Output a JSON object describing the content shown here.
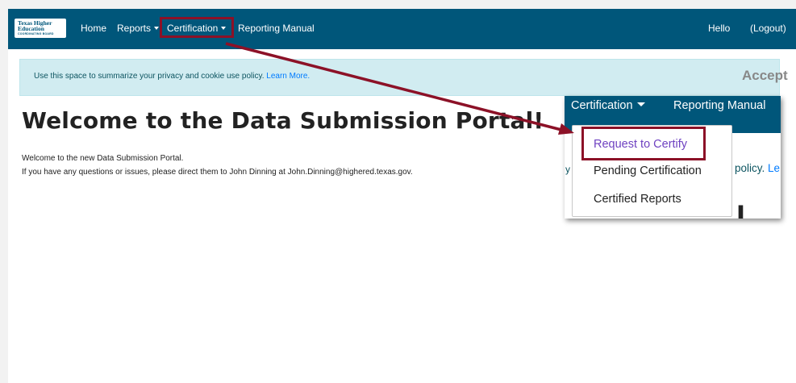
{
  "navbar": {
    "logo": {
      "line1": "Texas Higher",
      "line2": "Education",
      "line3": "COORDINATING BOARD"
    },
    "items": [
      {
        "label": "Home"
      },
      {
        "label": "Reports",
        "has_caret": true
      },
      {
        "label": "Certification",
        "has_caret": true,
        "highlighted": true
      },
      {
        "label": "Reporting Manual"
      }
    ],
    "right": {
      "greeting": "Hello",
      "logout": "(Logout)"
    },
    "background": "#00567a"
  },
  "cookie_banner": {
    "text": "Use this space to summarize your privacy and cookie use policy.",
    "link": "Learn More.",
    "accept": "Accept",
    "background": "#d1ecf1"
  },
  "main": {
    "title": "Welcome to the Data Submission Portal!",
    "line1": "Welcome to the new Data Submission Portal.",
    "line2": "If you have any questions or issues, please direct them to John Dinning at John.Dinning@highered.texas.gov."
  },
  "zoom_inset": {
    "nav": {
      "certification": "Certification",
      "reporting_manual": "Reporting Manual"
    },
    "background_fragments": {
      "policy": "policy.",
      "link_fragment": "Le",
      "edge_char": "y",
      "big_fragment": "l"
    },
    "dropdown": [
      {
        "label": "Request to Certify",
        "highlighted": true
      },
      {
        "label": "Pending Certification"
      },
      {
        "label": "Certified Reports"
      }
    ]
  },
  "annotation": {
    "color": "#8c1127",
    "icon": "arrow-icon"
  }
}
